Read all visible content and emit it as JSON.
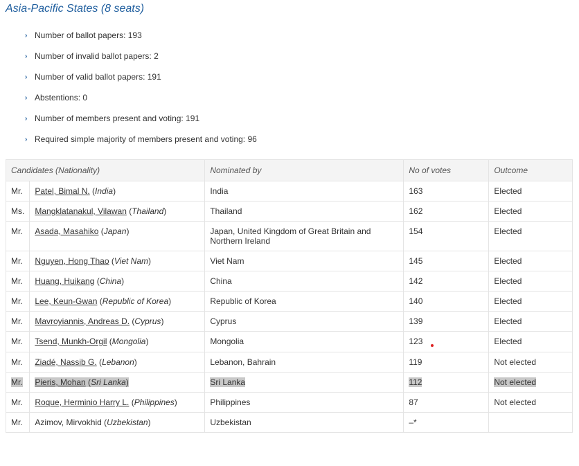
{
  "section": {
    "title": "Asia-Pacific States (8 seats)"
  },
  "stats": [
    "Number of ballot papers: 193",
    "Number of invalid ballot papers: 2",
    "Number of valid ballot papers: 191",
    "Abstentions: 0",
    "Number of members present and voting: 191",
    "Required simple majority of members present and voting: 96"
  ],
  "table": {
    "headers": [
      "Candidates (Nationality)",
      "Nominated by",
      "No of votes",
      "Outcome"
    ],
    "rows": [
      {
        "title": "Mr.",
        "name": "Patel, Bimal N.",
        "nationality": "India",
        "nominated": "India",
        "votes": "163",
        "outcome": "Elected"
      },
      {
        "title": "Ms.",
        "name": "Mangklatanakul, Vilawan",
        "nationality": "Thailand",
        "nominated": "Thailand",
        "votes": "162",
        "outcome": "Elected"
      },
      {
        "title": "Mr.",
        "name": "Asada, Masahiko",
        "nationality": "Japan",
        "nominated": "Japan, United Kingdom of Great Britain and Northern Ireland",
        "votes": "154",
        "outcome": "Elected"
      },
      {
        "title": "Mr.",
        "name": "Nguyen, Hong Thao",
        "nationality": "Viet Nam",
        "nominated": "Viet Nam",
        "votes": "145",
        "outcome": "Elected"
      },
      {
        "title": "Mr.",
        "name": "Huang, Huikang",
        "nationality": "China",
        "nominated": "China",
        "votes": "142",
        "outcome": "Elected"
      },
      {
        "title": "Mr.",
        "name": "Lee, Keun-Gwan",
        "nationality": "Republic of Korea",
        "nominated": "Republic of Korea",
        "votes": "140",
        "outcome": "Elected"
      },
      {
        "title": "Mr.",
        "name": "Mavroyiannis, Andreas D.",
        "nationality": "Cyprus",
        "nominated": "Cyprus",
        "votes": "139",
        "outcome": "Elected"
      },
      {
        "title": "Mr.",
        "name": "Tsend, Munkh-Orgil",
        "nationality": "Mongolia",
        "nominated": "Mongolia",
        "votes": "123",
        "outcome": "Elected"
      },
      {
        "title": "Mr.",
        "name": "Ziadé, Nassib G.",
        "nationality": "Lebanon",
        "nominated": "Lebanon, Bahrain",
        "votes": "119",
        "outcome": "Not elected"
      },
      {
        "title": "Mr.",
        "name": "Pieris, Mohan",
        "nationality": "Sri Lanka",
        "nominated": "Sri Lanka",
        "votes": "112",
        "outcome": "Not elected"
      },
      {
        "title": "Mr.",
        "name": "Roque, Herminio Harry L.",
        "nationality": "Philippines",
        "nominated": "Philippines",
        "votes": "87",
        "outcome": "Not elected"
      },
      {
        "title": "Mr.",
        "name": "Azimov, Mirvokhid",
        "nationality": "Uzbekistan",
        "nominated": "Uzbekistan",
        "votes": "–*",
        "outcome": ""
      }
    ]
  },
  "icons": {
    "bullet": "chevron-right-icon"
  },
  "colors": {
    "accent": "#1f5e9e",
    "highlight": "#c8c8c8",
    "marker": "#dd2222"
  }
}
